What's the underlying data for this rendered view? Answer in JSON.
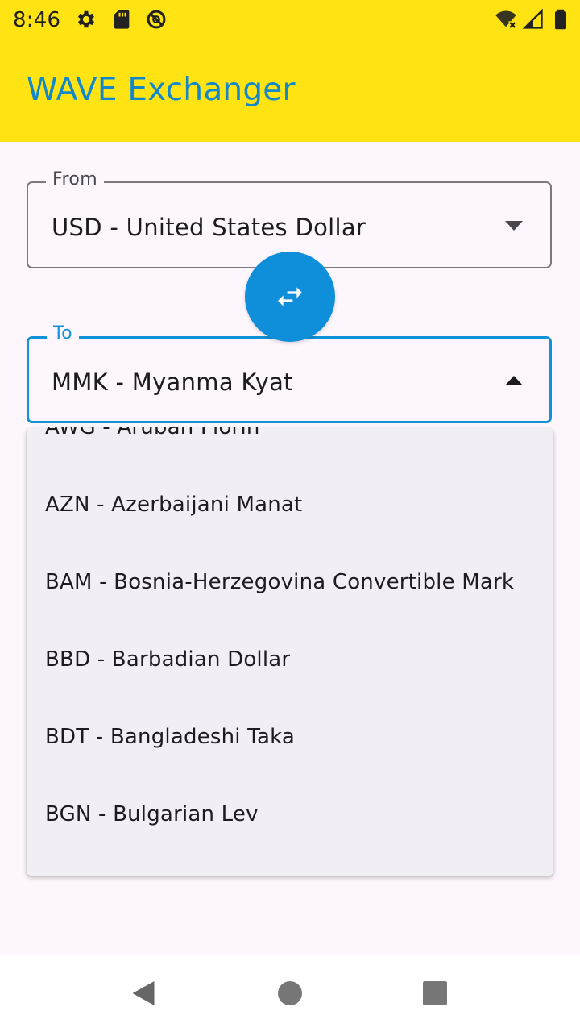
{
  "status_bar": {
    "time": "8:46",
    "icons": [
      "gear-icon",
      "sd-card-icon",
      "sync-off-icon",
      "wifi-off-icon",
      "cell-signal-icon",
      "battery-icon"
    ]
  },
  "app_bar": {
    "title": "WAVE Exchanger"
  },
  "from_field": {
    "label": "From",
    "value": "USD - United States Dollar"
  },
  "to_field": {
    "label": "To",
    "value": "MMK - Myanma Kyat"
  },
  "dropdown": {
    "items": [
      {
        "label": "AWG - Aruban Florin"
      },
      {
        "label": "AZN - Azerbaijani Manat"
      },
      {
        "label": "BAM - Bosnia-Herzegovina Convertible Mark"
      },
      {
        "label": "BBD - Barbadian Dollar"
      },
      {
        "label": "BDT - Bangladeshi Taka"
      },
      {
        "label": "BGN - Bulgarian Lev"
      }
    ]
  },
  "colors": {
    "app_bar": "#ffe312",
    "accent": "#1188cc",
    "swap_button": "#0f8ed9",
    "menu_background": "#f2eef6",
    "page_background": "#fdf7fd"
  },
  "nav_bar": {
    "icons": [
      "back-icon",
      "home-icon",
      "recents-icon"
    ]
  }
}
